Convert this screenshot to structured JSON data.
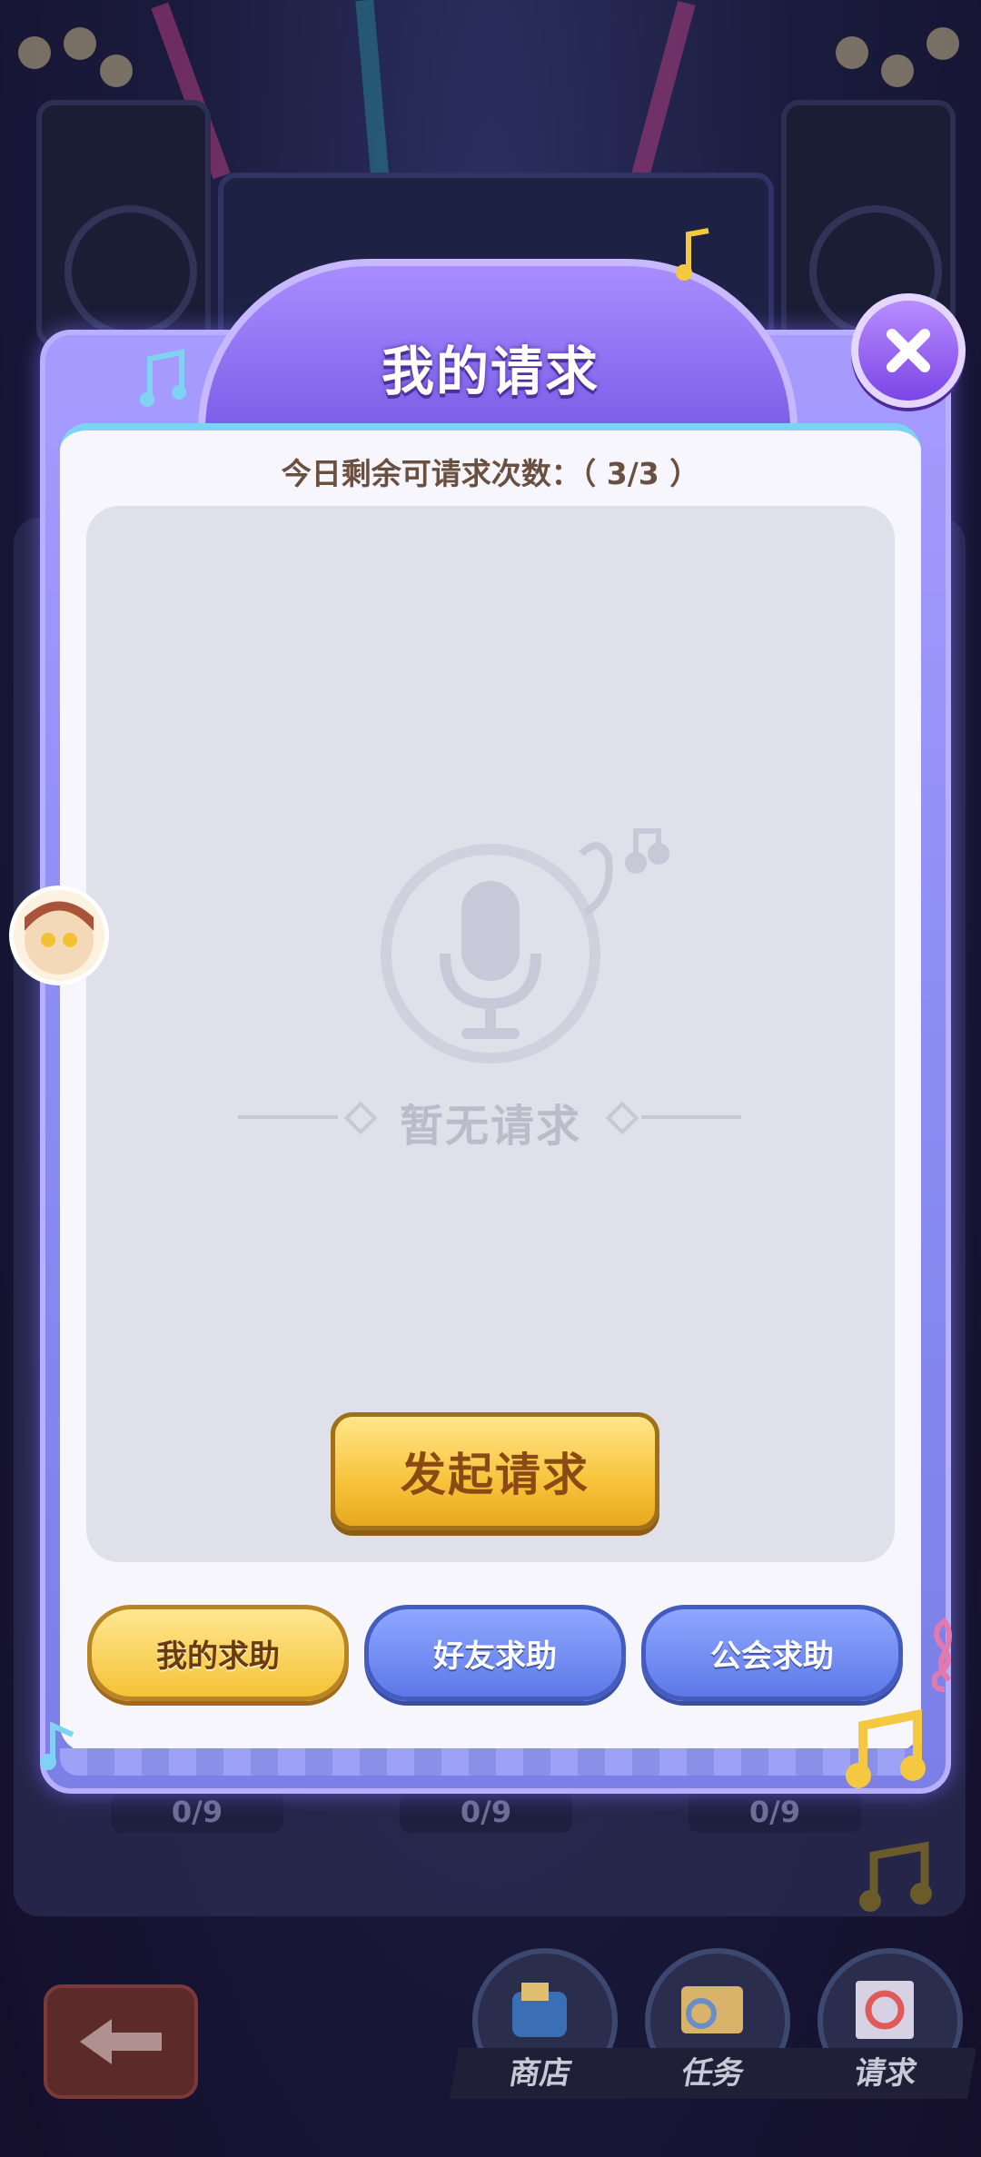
{
  "modal": {
    "title": "我的请求",
    "remaining_label": "今日剩余可请求次数：（ 3/3 ）",
    "empty_text": "暂无请求",
    "launch_button": "发起请求",
    "tabs": [
      {
        "label": "我的求助",
        "active": true
      },
      {
        "label": "好友求助",
        "active": false
      },
      {
        "label": "公会求助",
        "active": false
      }
    ]
  },
  "background": {
    "counters": [
      "0/9",
      "0/9",
      "0/9"
    ]
  },
  "bottom_nav": {
    "items": [
      {
        "label": "商店",
        "icon": "mailbox-icon"
      },
      {
        "label": "任务",
        "icon": "task-book-icon"
      },
      {
        "label": "请求",
        "icon": "request-stamp-icon"
      }
    ]
  },
  "colors": {
    "modal_purple": "#8a8cf2",
    "active_tab_gold": "#f4c237",
    "inactive_tab_blue": "#5e79e8",
    "content_gray": "#dfe0ea"
  }
}
